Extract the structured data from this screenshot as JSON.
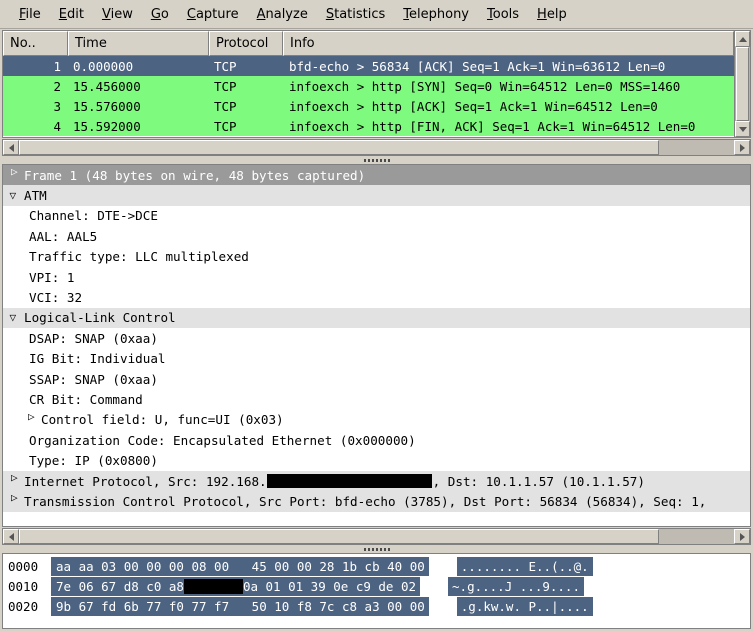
{
  "menu": {
    "items": [
      {
        "label": "File",
        "acc": "F",
        "rest": "ile"
      },
      {
        "label": "Edit",
        "acc": "E",
        "rest": "dit"
      },
      {
        "label": "View",
        "acc": "V",
        "rest": "iew"
      },
      {
        "label": "Go",
        "acc": "G",
        "rest": "o"
      },
      {
        "label": "Capture",
        "acc": "C",
        "rest": "apture"
      },
      {
        "label": "Analyze",
        "acc": "A",
        "rest": "nalyze"
      },
      {
        "label": "Statistics",
        "acc": "S",
        "rest": "tatistics"
      },
      {
        "label": "Telephony",
        "acc": "T",
        "rest": "elephony"
      },
      {
        "label": "Tools",
        "acc": "T",
        "rest": "ools"
      },
      {
        "label": "Help",
        "acc": "H",
        "rest": "elp"
      }
    ]
  },
  "packet_list": {
    "columns": [
      {
        "key": "no",
        "label": "No.."
      },
      {
        "key": "time",
        "label": "Time"
      },
      {
        "key": "protocol",
        "label": "Protocol"
      },
      {
        "key": "info",
        "label": "Info"
      }
    ],
    "rows": [
      {
        "no": "1",
        "time": "0.000000",
        "protocol": "TCP",
        "info": "bfd-echo > 56834 [ACK] Seq=1 Ack=1 Win=63612 Len=0",
        "state": "selected"
      },
      {
        "no": "2",
        "time": "15.456000",
        "protocol": "TCP",
        "info": "infoexch > http [SYN] Seq=0 Win=64512 Len=0 MSS=1460",
        "state": "green"
      },
      {
        "no": "3",
        "time": "15.576000",
        "protocol": "TCP",
        "info": "infoexch > http [ACK] Seq=1 Ack=1 Win=64512 Len=0",
        "state": "green"
      },
      {
        "no": "4",
        "time": "15.592000",
        "protocol": "TCP",
        "info": "infoexch > http [FIN, ACK] Seq=1 Ack=1 Win=64512 Len=0",
        "state": "green"
      }
    ]
  },
  "detail_tree": {
    "rows": [
      {
        "label": "Frame 1 (48 bytes on wire, 48 bytes captured)",
        "toggle": "closed",
        "level": 0,
        "style": "selected"
      },
      {
        "label": "ATM",
        "toggle": "open",
        "level": 0,
        "style": "header"
      },
      {
        "label": "Channel: DTE->DCE",
        "toggle": "none",
        "level": 1,
        "style": "plain"
      },
      {
        "label": "AAL: AAL5",
        "toggle": "none",
        "level": 1,
        "style": "plain"
      },
      {
        "label": "Traffic type: LLC multiplexed",
        "toggle": "none",
        "level": 1,
        "style": "plain"
      },
      {
        "label": "VPI: 1",
        "toggle": "none",
        "level": 1,
        "style": "plain"
      },
      {
        "label": "VCI: 32",
        "toggle": "none",
        "level": 1,
        "style": "plain"
      },
      {
        "label": "Logical-Link Control",
        "toggle": "open",
        "level": 0,
        "style": "header"
      },
      {
        "label": "DSAP: SNAP (0xaa)",
        "toggle": "none",
        "level": 1,
        "style": "plain"
      },
      {
        "label": "IG Bit: Individual",
        "toggle": "none",
        "level": 1,
        "style": "plain"
      },
      {
        "label": "SSAP: SNAP (0xaa)",
        "toggle": "none",
        "level": 1,
        "style": "plain"
      },
      {
        "label": "CR Bit: Command",
        "toggle": "none",
        "level": 1,
        "style": "plain"
      },
      {
        "label": "Control field: U, func=UI (0x03)",
        "toggle": "closed-child",
        "level": 1,
        "style": "plain"
      },
      {
        "label": "Organization Code: Encapsulated Ethernet (0x000000)",
        "toggle": "none",
        "level": 1,
        "style": "plain"
      },
      {
        "label": "Type: IP (0x0800)",
        "toggle": "none",
        "level": 1,
        "style": "plain"
      },
      {
        "label_pre": "Internet Protocol, Src: 192.168.",
        "redacted": true,
        "redact_width": 165,
        "label_post": ", Dst: 10.1.1.57 (10.1.1.57)",
        "toggle": "closed",
        "level": 0,
        "style": "header"
      },
      {
        "label": "Transmission Control Protocol, Src Port: bfd-echo (3785), Dst Port: 56834 (56834), Seq: 1,",
        "toggle": "closed",
        "level": 0,
        "style": "header"
      }
    ]
  },
  "hex_pane": {
    "rows": [
      {
        "offset": "0000",
        "bytes_left": "aa aa 03 00 00 00 08 00",
        "bytes_right": "45 00 00 28 1b cb 40 00",
        "ascii": "........ E..(..@.",
        "redacted": false
      },
      {
        "offset": "0010",
        "bytes_left_pre": "7e 06 67 d8 c0 a8 ",
        "redacted": true,
        "redact_width": 59,
        "bytes_right": "0a 01 01 39 0e c9 de 02",
        "ascii": "~.g....J ...9....",
        "bytes_left": "7e 06 67 d8 c0 a8"
      },
      {
        "offset": "0020",
        "bytes_left": "9b 67 fd 6b 77 f0 77 f7",
        "bytes_right": "50 10 f8 7c c8 a3 00 00",
        "ascii": ".g.kw.w. P..|....",
        "redacted": false
      }
    ]
  },
  "scrollbars": {
    "packet_list_vertical": "visible",
    "packet_list_horizontal": "visible",
    "detail_horizontal": "visible"
  },
  "colors": {
    "window_bg": "#d6d2c8",
    "selected_row": "#4c6382",
    "tcp_green_row": "#7efa7e",
    "tree_header_row": "#e2e2e2",
    "tree_selected_row": "#9a9a9a",
    "hex_highlight": "#4c6382",
    "redaction": "#000000"
  }
}
